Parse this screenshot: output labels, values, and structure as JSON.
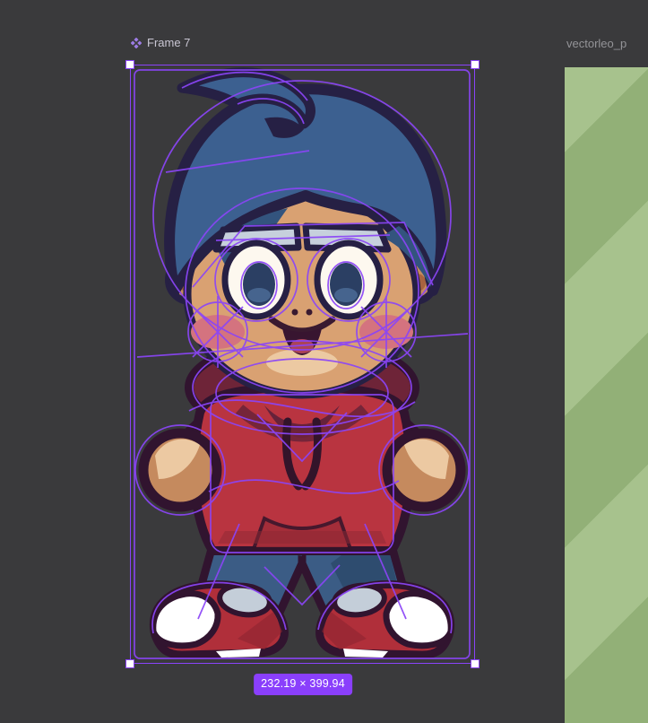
{
  "header": {
    "selected_frame_label": "Frame 7",
    "adjacent_frame_label": "vectorleo_p"
  },
  "selection": {
    "dimensions_badge": "232.19 × 399.94"
  },
  "icons": {
    "frame_label_icon": "component-diamonds-icon"
  },
  "colors": {
    "canvas_bg": "#3a3a3c",
    "selection": "#8a43f9",
    "badge_bg": "#8a3ffc",
    "badge_text": "#ffffff",
    "frame_label_text": "#c9c6d3",
    "frame_label_icon": "#9d7ce4",
    "adjacent_label_text": "#949498",
    "stripe_light": "#a7c28d",
    "stripe_dark": "#92b077",
    "overlay_purple": "#8b45f7",
    "outline_navy": "#262044",
    "outline_plum": "#31142f",
    "hair_blue": "#3c6090",
    "skin": "#d9a172",
    "skin_light": "#ecc9a2",
    "blush_pink": "#d4737f",
    "hoodie_red": "#b93440",
    "hood_maroon": "#6e2438",
    "jeans_blue": "#3b5c85",
    "jeans_shadow": "#2b4768",
    "sneaker_red": "#b02f3a",
    "sneaker_gray": "#c4ced9"
  }
}
